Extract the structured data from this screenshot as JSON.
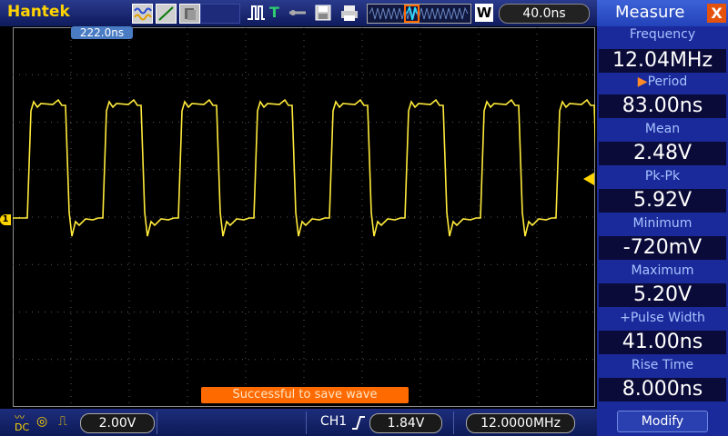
{
  "brand": "Hantek",
  "timebase": "40.0ns",
  "memory_badge": "W",
  "trigger_position": "222.0ns",
  "channel_marker": "1",
  "message": "Successful to save wave",
  "bottom": {
    "volts_div": "2.00V",
    "trigger_channel": "CH1",
    "trigger_level": "1.84V",
    "trigger_freq": "12.0000MHz"
  },
  "panel": {
    "title": "Measure",
    "close": "X",
    "measures": [
      {
        "label": "Frequency",
        "value": "12.04MHz"
      },
      {
        "label": "Period",
        "value": "83.00ns"
      },
      {
        "label": "Mean",
        "value": "2.48V"
      },
      {
        "label": "Pk-Pk",
        "value": "5.92V"
      },
      {
        "label": "Minimum",
        "value": "-720mV"
      },
      {
        "label": "Maximum",
        "value": "5.20V"
      },
      {
        "label": "+Pulse Width",
        "value": "41.00ns"
      },
      {
        "label": "Rise Time",
        "value": "8.000ns"
      }
    ],
    "modify": "Modify"
  },
  "colors": {
    "trace": "#ffeb3b",
    "panel": "#1a2a9a",
    "message": "#ff6a00"
  }
}
